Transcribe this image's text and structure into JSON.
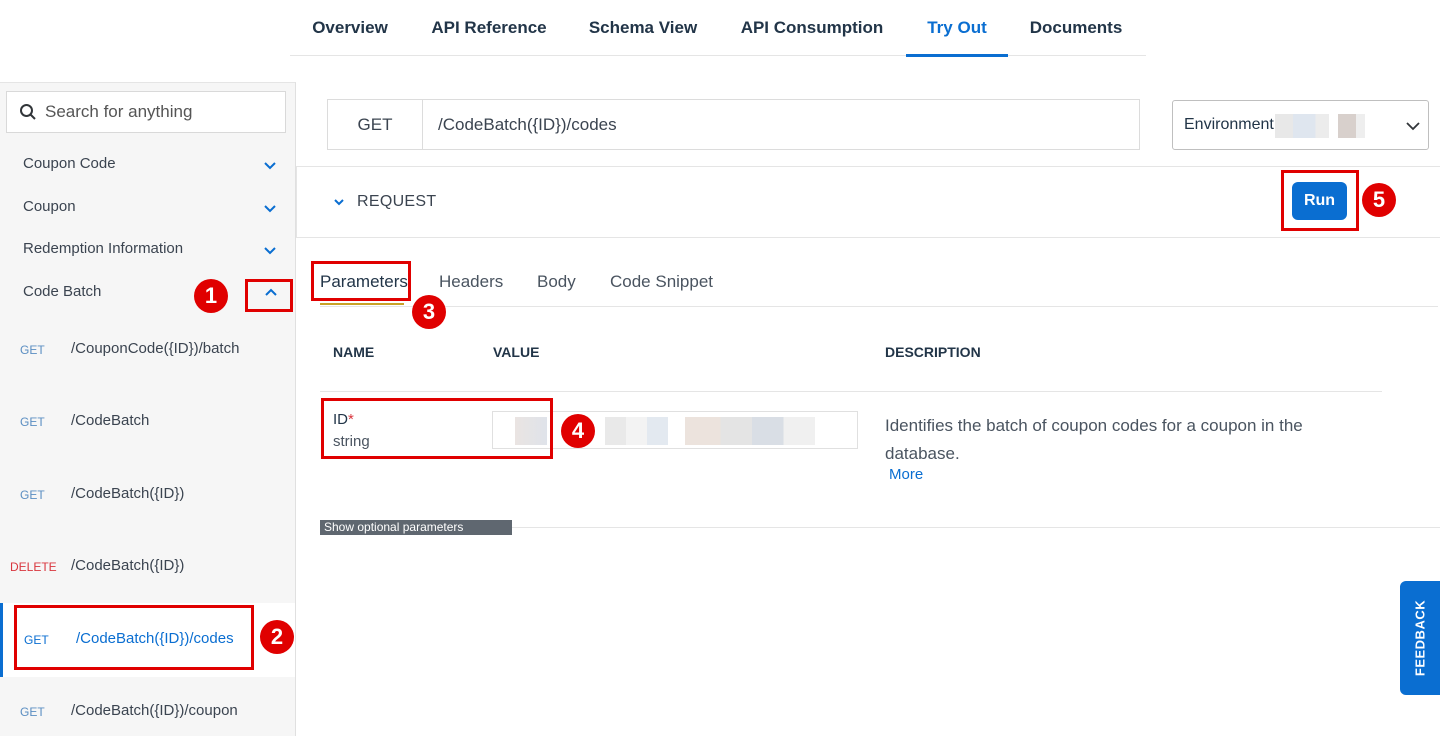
{
  "top_tabs": [
    {
      "label": "Overview"
    },
    {
      "label": "API Reference"
    },
    {
      "label": "Schema View"
    },
    {
      "label": "API Consumption"
    },
    {
      "label": "Try Out",
      "active": true
    },
    {
      "label": "Documents"
    }
  ],
  "sidebar": {
    "search_placeholder": "Search for anything",
    "categories": [
      {
        "label": "Coupon Code"
      },
      {
        "label": "Coupon"
      },
      {
        "label": "Redemption Information"
      },
      {
        "label": "Code Batch"
      }
    ],
    "endpoints": [
      {
        "method": "GET",
        "path": "/CouponCode({ID})/batch"
      },
      {
        "method": "GET",
        "path": "/CodeBatch"
      },
      {
        "method": "GET",
        "path": "/CodeBatch({ID})"
      },
      {
        "method": "DELETE",
        "path": "/CodeBatch({ID})"
      },
      {
        "method": "GET",
        "path": "/CodeBatch({ID})/codes",
        "active": true
      },
      {
        "method": "GET",
        "path": "/CodeBatch({ID})/coupon"
      }
    ]
  },
  "request": {
    "method": "GET",
    "url": "/CodeBatch({ID})/codes",
    "environment_label": "Environment: c",
    "section_label": "REQUEST",
    "run_label": "Run"
  },
  "sub_tabs": [
    {
      "label": "Parameters",
      "active": true
    },
    {
      "label": "Headers"
    },
    {
      "label": "Body"
    },
    {
      "label": "Code Snippet"
    }
  ],
  "params_table": {
    "headers": {
      "name": "NAME",
      "value": "VALUE",
      "description": "DESCRIPTION"
    },
    "rows": [
      {
        "name": "ID",
        "required_mark": "*",
        "type": "string",
        "description": "Identifies the batch of coupon codes for a coupon in the database.",
        "more": "More"
      }
    ],
    "optional_label": "Show optional parameters"
  },
  "feedback_label": "FEEDBACK",
  "annotations": [
    "1",
    "2",
    "3",
    "4",
    "5"
  ],
  "colors": {
    "accent": "#0a6ed1",
    "annotation": "#e00000",
    "delete": "#d9363e"
  }
}
